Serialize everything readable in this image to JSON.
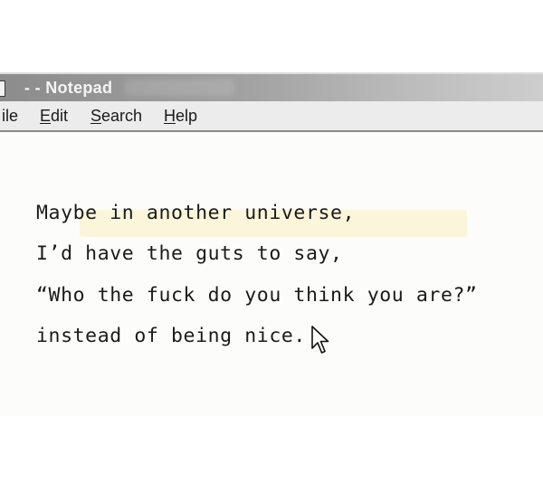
{
  "window": {
    "title": "- - Notepad"
  },
  "menu": {
    "items": [
      {
        "label": "ile",
        "accel": ""
      },
      {
        "label": "Edit",
        "accel": "E"
      },
      {
        "label": "Search",
        "accel": "S"
      },
      {
        "label": "Help",
        "accel": "H"
      }
    ]
  },
  "editor": {
    "lines": [
      "Maybe in another universe,",
      "I’d have the guts to say,",
      "“Who the fuck do you think you are?”",
      "instead of being nice."
    ],
    "highlighted_line_index": 2
  },
  "icons": {
    "document": "notepad-document-icon",
    "cursor": "mouse-pointer-icon"
  },
  "colors": {
    "title_bar": "#8c8c8c",
    "menu_bar": "#ececec",
    "highlight": "#fbf5da",
    "text": "#1b1b1b"
  }
}
